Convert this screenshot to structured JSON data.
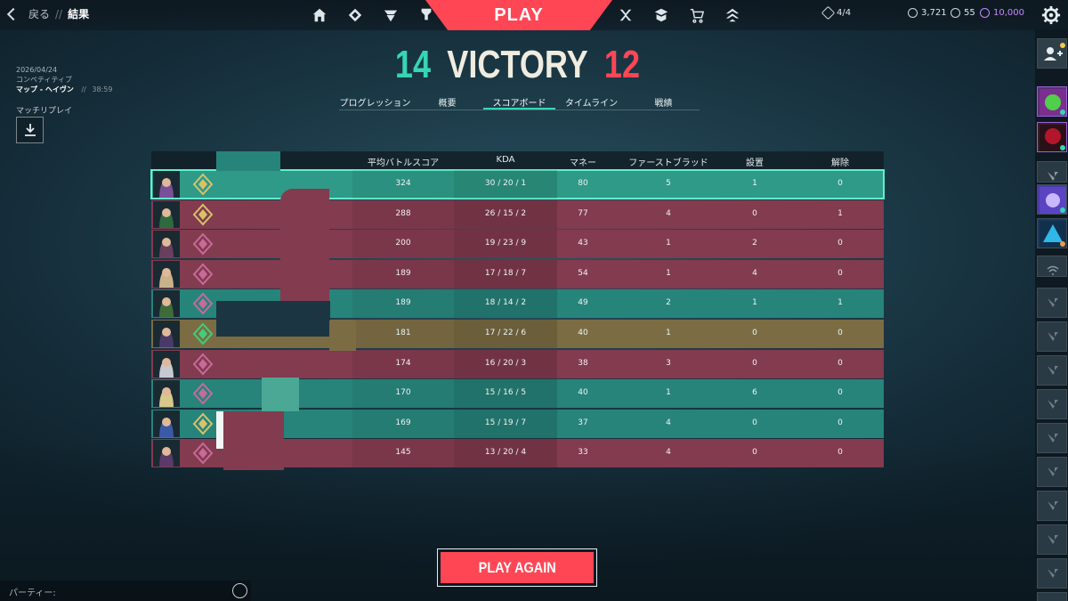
{
  "topbar": {
    "back_label": "戻る",
    "separator": "//",
    "current_label": "結果",
    "play_label": "PLAY",
    "nav_left_icons": [
      "home-icon",
      "career-icon",
      "battlepass-icon",
      "collection-icon"
    ],
    "nav_right_icons": [
      "agents-icon",
      "career-stats-icon",
      "store-icon",
      "rank-icon"
    ],
    "unlocks": "4/4",
    "valorant_points": "3,721",
    "radianite": "55",
    "kingdom_credits": "10,000",
    "colors": {
      "accent": "#ff4655",
      "win": "#35d6b5",
      "kingdom": "#c689ff"
    }
  },
  "match": {
    "date": "2026/04/24",
    "mode": "コンペティティブ",
    "map": "マップ - ヘイヴン",
    "dur_sep": "//",
    "duration": "38:59",
    "replay_label": "マッチリプレイ"
  },
  "result": {
    "team_score": "14",
    "label": "VICTORY",
    "enemy_score": "12"
  },
  "tabs": [
    {
      "label": "プログレッション",
      "active": false
    },
    {
      "label": "概要",
      "active": false
    },
    {
      "label": "スコアボード",
      "active": true
    },
    {
      "label": "タイムライン",
      "active": false
    },
    {
      "label": "戦績",
      "active": false
    }
  ],
  "scoreboard": {
    "headers": {
      "acs": "平均バトルスコア",
      "kda": "KDA",
      "econ": "マネー",
      "first_blood": "ファーストブラッド",
      "plants": "設置",
      "defuses": "解除"
    },
    "rows": [
      {
        "team": "self",
        "acs": "324",
        "kda": "30 / 20 / 1",
        "econ": "80",
        "fb": "5",
        "plants": "1",
        "defuses": "0"
      },
      {
        "team": "enemy",
        "acs": "288",
        "kda": "26 / 15 / 2",
        "econ": "77",
        "fb": "4",
        "plants": "0",
        "defuses": "1"
      },
      {
        "team": "enemy",
        "acs": "200",
        "kda": "19 / 23 / 9",
        "econ": "43",
        "fb": "1",
        "plants": "2",
        "defuses": "0"
      },
      {
        "team": "enemy",
        "acs": "189",
        "kda": "17 / 18 / 7",
        "econ": "54",
        "fb": "1",
        "plants": "4",
        "defuses": "0"
      },
      {
        "team": "ally",
        "acs": "189",
        "kda": "18 / 14 / 2",
        "econ": "49",
        "fb": "2",
        "plants": "1",
        "defuses": "1"
      },
      {
        "team": "party",
        "acs": "181",
        "kda": "17 / 22 / 6",
        "econ": "40",
        "fb": "1",
        "plants": "0",
        "defuses": "0"
      },
      {
        "team": "enemy",
        "acs": "174",
        "kda": "16 / 20 / 3",
        "econ": "38",
        "fb": "3",
        "plants": "0",
        "defuses": "0"
      },
      {
        "team": "ally",
        "acs": "170",
        "kda": "15 / 16 / 5",
        "econ": "40",
        "fb": "1",
        "plants": "6",
        "defuses": "0"
      },
      {
        "team": "ally",
        "acs": "169",
        "kda": "15 / 19 / 7",
        "econ": "37",
        "fb": "4",
        "plants": "0",
        "defuses": "0"
      },
      {
        "team": "enemy",
        "acs": "145",
        "kda": "13 / 20 / 4",
        "econ": "33",
        "fb": "4",
        "plants": "0",
        "defuses": "0"
      }
    ]
  },
  "play_again_label": "PLAY AGAIN",
  "party_label": "パーティー:"
}
